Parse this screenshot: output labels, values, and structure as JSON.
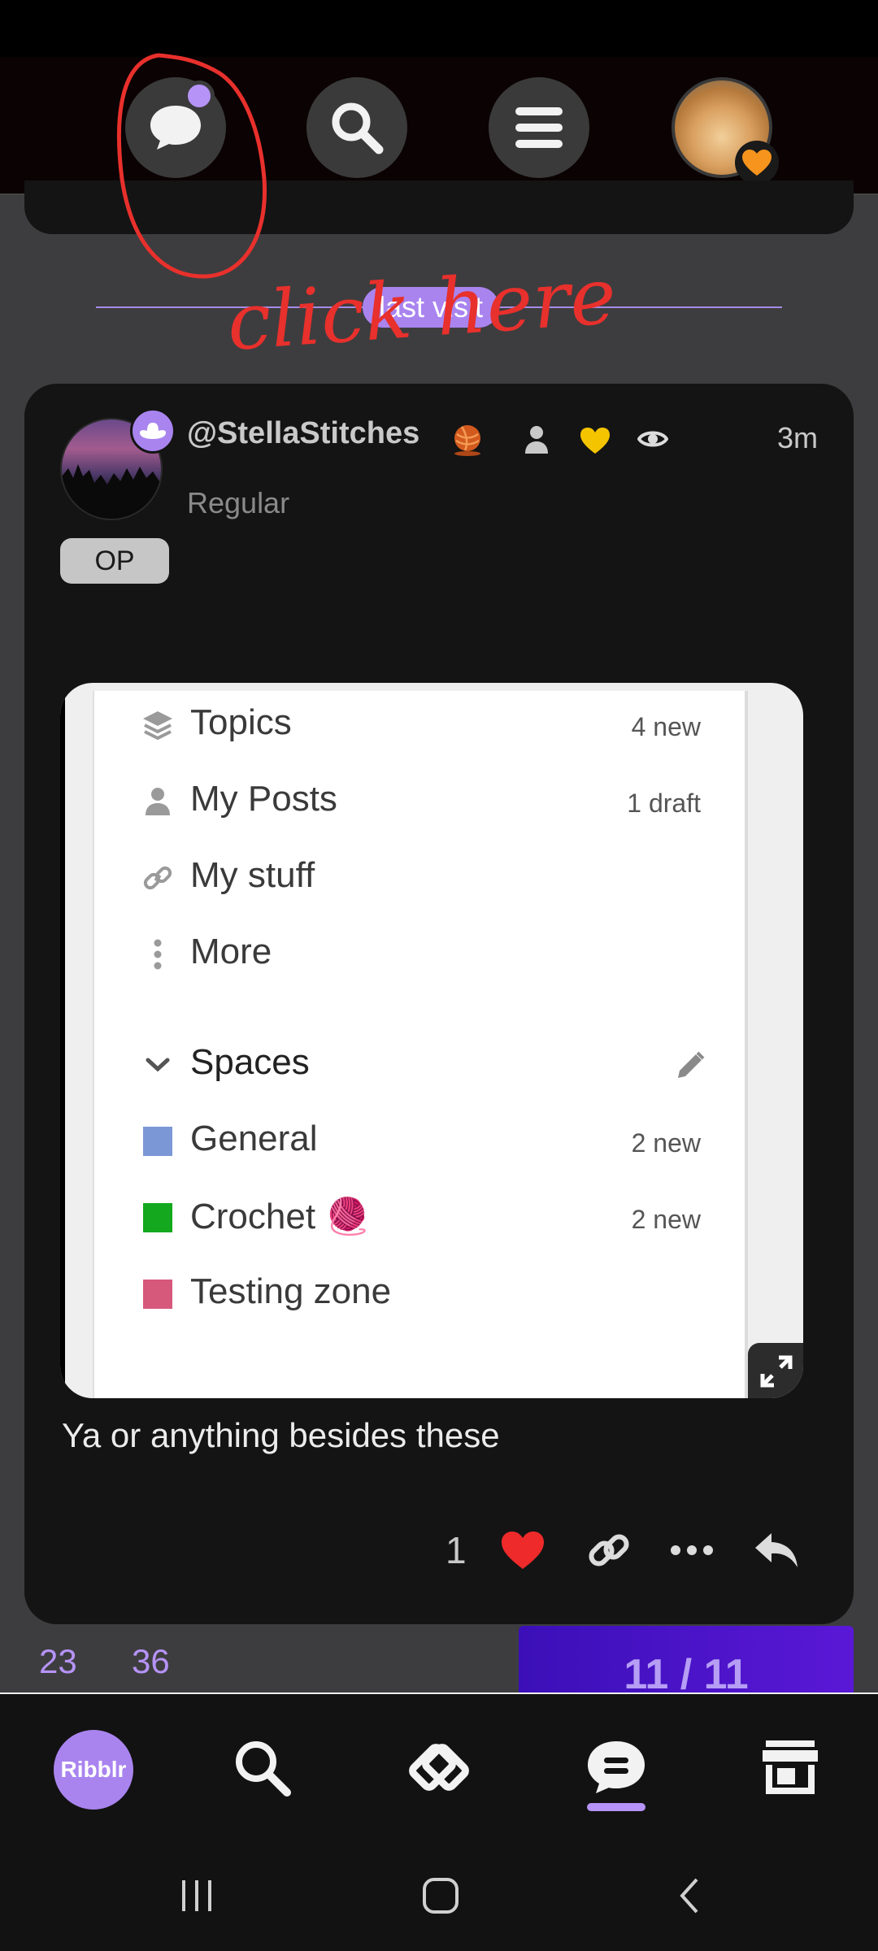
{
  "top_bar": {
    "buttons": [
      {
        "name": "chat",
        "icon": "chat-bubble-icon",
        "has_unread_dot": true
      },
      {
        "name": "search",
        "icon": "search-icon"
      },
      {
        "name": "menu",
        "icon": "hamburger-menu-icon"
      },
      {
        "name": "profile",
        "icon": "avatar",
        "badge_icon": "orange-heart-icon"
      }
    ]
  },
  "divider": {
    "label": "last visit"
  },
  "annotation": {
    "text": "click here",
    "color": "#e8302c"
  },
  "post": {
    "username": "@StellaStitches",
    "user_title": "Regular",
    "op_badge": "OP",
    "time": "3m",
    "text": "Ya or anything besides these",
    "like_count": "1",
    "header_icons": [
      "yarn-ball-icon",
      "person-icon",
      "yellow-heart-icon",
      "eye-icon"
    ],
    "avatar_badge_icon": "cowboy-hat-icon",
    "actions": [
      "heart-icon",
      "link-icon",
      "more-icon",
      "reply-icon"
    ]
  },
  "embedded_screenshot": {
    "items": [
      {
        "label": "Topics",
        "count": "4 new",
        "icon": "layers-icon"
      },
      {
        "label": "My Posts",
        "count": "1 draft",
        "icon": "person-icon"
      },
      {
        "label": "My stuff",
        "count": "",
        "icon": "link-icon"
      },
      {
        "label": "More",
        "count": "",
        "icon": "vertical-dots-icon"
      }
    ],
    "section": {
      "label": "Spaces",
      "icon": "chevron-down-icon",
      "edit_icon": "pencil-icon"
    },
    "spaces": [
      {
        "label": "General",
        "count": "2 new",
        "color": "#7b97d6"
      },
      {
        "label": "Crochet",
        "count": "2 new",
        "color": "#13a81d",
        "emoji": "🧶"
      },
      {
        "label": "Testing zone",
        "count": "",
        "color": "#d6587a"
      }
    ]
  },
  "footer_stats": {
    "a": "23",
    "b": "36"
  },
  "progress": {
    "label": "11 / 11",
    "current": 11,
    "total": 11
  },
  "bottom_nav": {
    "home_label": "Ribblr",
    "items": [
      "home",
      "search-icon",
      "patterns-icon",
      "chat-icon",
      "shop-icon"
    ],
    "active": "chat",
    "accent": "#a984ef"
  },
  "system_nav": [
    "recents-icon",
    "home-icon",
    "back-icon"
  ]
}
